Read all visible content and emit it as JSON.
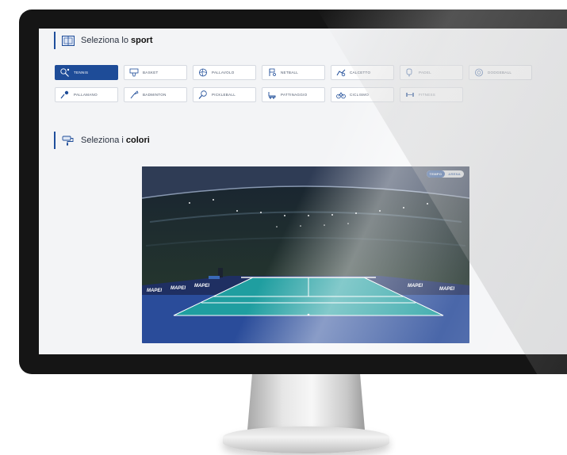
{
  "sport_section": {
    "prefix": "Seleziona lo",
    "emphasis": "sport"
  },
  "color_section": {
    "prefix": "Seleziona i",
    "emphasis": "colori"
  },
  "sports": [
    {
      "label": "TENNIS",
      "icon": "tennis-icon",
      "selected": true
    },
    {
      "label": "BASKET",
      "icon": "basketball-icon",
      "selected": false
    },
    {
      "label": "PALLAVOLO",
      "icon": "volleyball-icon",
      "selected": false
    },
    {
      "label": "NETBALL",
      "icon": "netball-icon",
      "selected": false
    },
    {
      "label": "CALCETTO",
      "icon": "soccer-icon",
      "selected": false
    },
    {
      "label": "PADEL",
      "icon": "padel-icon",
      "selected": false
    },
    {
      "label": "DODGEBALL",
      "icon": "dodgeball-icon",
      "selected": false
    },
    {
      "label": "PALLAMANO",
      "icon": "handball-icon",
      "selected": false
    },
    {
      "label": "BADMINTON",
      "icon": "badminton-icon",
      "selected": false
    },
    {
      "label": "PICKLEBALL",
      "icon": "pickleball-icon",
      "selected": false
    },
    {
      "label": "PATTINAGGIO",
      "icon": "skating-icon",
      "selected": false
    },
    {
      "label": "CICLISMO",
      "icon": "cycling-icon",
      "selected": false
    },
    {
      "label": "FITNESS",
      "icon": "fitness-icon",
      "selected": false
    }
  ],
  "preview": {
    "toggle_on": "TEMPO",
    "toggle_off": "ARENA",
    "ad_text": "MAPEI",
    "colors": {
      "court_inner": "#1f9ea0",
      "court_outer": "#2a4c9a",
      "sky": "#e8c9d6"
    }
  },
  "accent_color": "#1e4c98"
}
